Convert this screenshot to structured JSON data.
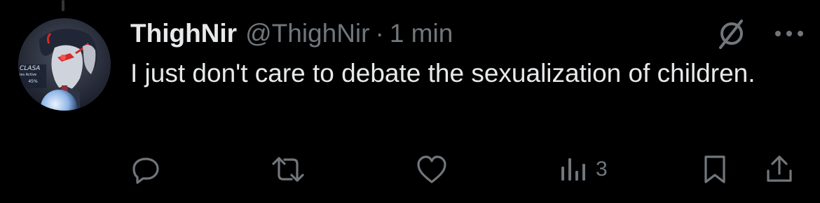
{
  "tweet": {
    "display_name": "ThighNir",
    "handle": "@ThighNir",
    "separator": "·",
    "timestamp": "1 min",
    "text": "I just don't care to debate the sexualization of children."
  },
  "avatar": {
    "badge_lines": [
      "CLASA",
      "ies Active",
      "45%"
    ]
  },
  "icons": {
    "top_right": [
      "grok-icon",
      "more-options-icon"
    ],
    "actions": [
      "reply-icon",
      "repost-icon",
      "like-icon",
      "views-icon",
      "bookmark-icon",
      "share-icon"
    ]
  },
  "metrics": {
    "views": "3"
  },
  "colors": {
    "background": "#000000",
    "text_primary": "#e7e9ea",
    "text_secondary": "#71767b"
  }
}
